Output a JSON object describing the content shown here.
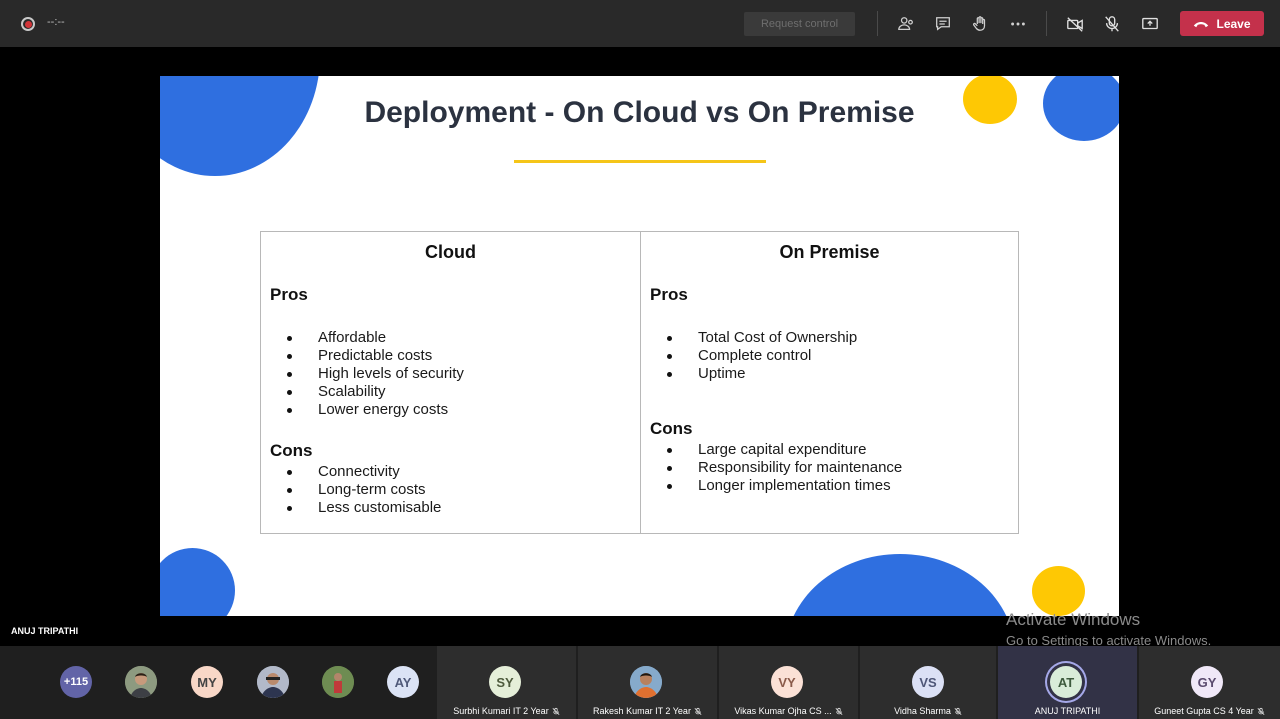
{
  "meeting": {
    "timer": "--:--",
    "request_control": "Request control",
    "leave_label": "Leave",
    "presenter_name": "ANUJ TRIPATHI"
  },
  "toolbar_icons": [
    "participants-icon",
    "chat-icon",
    "raise-hand-icon",
    "more-options-icon",
    "camera-off-icon",
    "mic-off-icon",
    "share-screen-icon"
  ],
  "slide": {
    "title": "Deployment - On Cloud vs On Premise",
    "cloud": {
      "heading": "Cloud",
      "pros_label": "Pros",
      "pros": [
        "Affordable",
        "Predictable costs",
        "High levels of security",
        "Scalability",
        "Lower energy costs"
      ],
      "cons_label": "Cons",
      "cons": [
        "Connectivity",
        "Long-term costs",
        "Less customisable"
      ]
    },
    "on_premise": {
      "heading": "On Premise",
      "pros_label": "Pros",
      "pros": [
        "Total Cost of Ownership",
        "Complete control",
        "Uptime"
      ],
      "cons_label": "Cons",
      "cons": [
        "Large capital expenditure",
        "Responsibility for maintenance",
        "Longer implementation times"
      ]
    }
  },
  "watermark": {
    "line1": "Activate Windows",
    "line2": "Go to Settings to activate Windows."
  },
  "participants": {
    "overflow_count": "+115",
    "avatars": [
      "MY",
      "AY"
    ],
    "tiles": [
      {
        "initials": "SY",
        "name": "Surbhi Kumari IT 2 Year"
      },
      {
        "initials": "",
        "name": "Rakesh Kumar IT 2 Year"
      },
      {
        "initials": "VY",
        "name": "Vikas Kumar Ojha CS ..."
      },
      {
        "initials": "VS",
        "name": "Vidha Sharma"
      },
      {
        "initials": "AT",
        "name": "ANUJ TRIPATHI"
      },
      {
        "initials": "GY",
        "name": "Guneet Gupta CS 4 Year"
      }
    ]
  },
  "colors": {
    "leave": "#c4314b",
    "accent_blue": "#2f6fe0",
    "accent_yellow": "#fec804",
    "teams_purple": "#6264a7"
  }
}
